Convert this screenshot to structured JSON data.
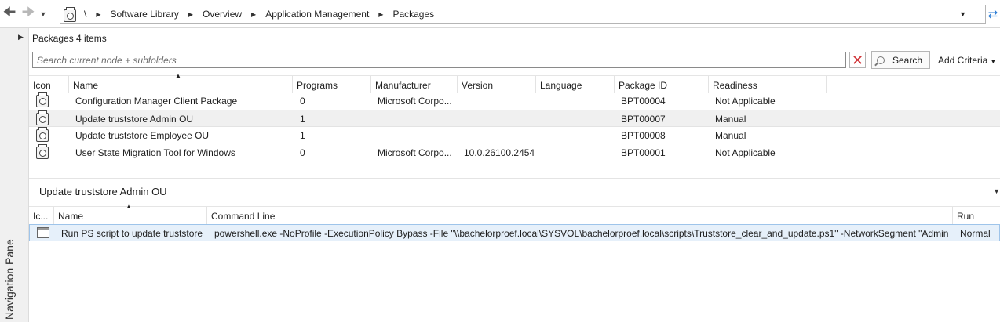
{
  "address_bar": {
    "root": "\\",
    "crumbs": [
      "Software Library",
      "Overview",
      "Application Management",
      "Packages"
    ]
  },
  "nav_pane": {
    "label": "Navigation Pane"
  },
  "main": {
    "title": "Packages 4 items",
    "search_placeholder": "Search current node + subfolders",
    "search_button": "Search",
    "add_criteria": "Add Criteria"
  },
  "grid": {
    "columns": [
      "Icon",
      "Name",
      "Programs",
      "Manufacturer",
      "Version",
      "Language",
      "Package ID",
      "Readiness"
    ],
    "rows": [
      {
        "name": "Configuration Manager Client Package",
        "programs": "0",
        "manufacturer": "Microsoft Corpo...",
        "version": "",
        "language": "",
        "package_id": "BPT00004",
        "readiness": "Not Applicable"
      },
      {
        "name": "Update truststore Admin OU",
        "programs": "1",
        "manufacturer": "",
        "version": "",
        "language": "",
        "package_id": "BPT00007",
        "readiness": "Manual"
      },
      {
        "name": "Update truststore Employee OU",
        "programs": "1",
        "manufacturer": "",
        "version": "",
        "language": "",
        "package_id": "BPT00008",
        "readiness": "Manual"
      },
      {
        "name": "User State Migration Tool for Windows",
        "programs": "0",
        "manufacturer": "Microsoft Corpo...",
        "version": "10.0.26100.2454",
        "language": "",
        "package_id": "BPT00001",
        "readiness": "Not Applicable"
      }
    ]
  },
  "detail": {
    "title": "Update truststore Admin OU",
    "columns": [
      "Ic...",
      "Name",
      "Command Line",
      "Run"
    ],
    "rows": [
      {
        "name": "Run PS script to update truststore",
        "command_line": "powershell.exe -NoProfile -ExecutionPolicy Bypass -File \"\\\\bachelorproef.local\\SYSVOL\\bachelorproef.local\\scripts\\Truststore_clear_and_update.ps1\" -NetworkSegment \"Admin\"",
        "run": "Normal"
      }
    ]
  },
  "colors": {
    "selected_row": "#f0f0f0",
    "highlight_row": "#e6f0fa",
    "highlight_border": "#9ec4ea",
    "clear_red": "#d13438"
  },
  "icons": [
    "back-arrow-icon",
    "forward-arrow-icon",
    "package-icon",
    "chevron-right-icon",
    "refresh-icon",
    "clear-icon",
    "search-icon",
    "program-icon"
  ]
}
